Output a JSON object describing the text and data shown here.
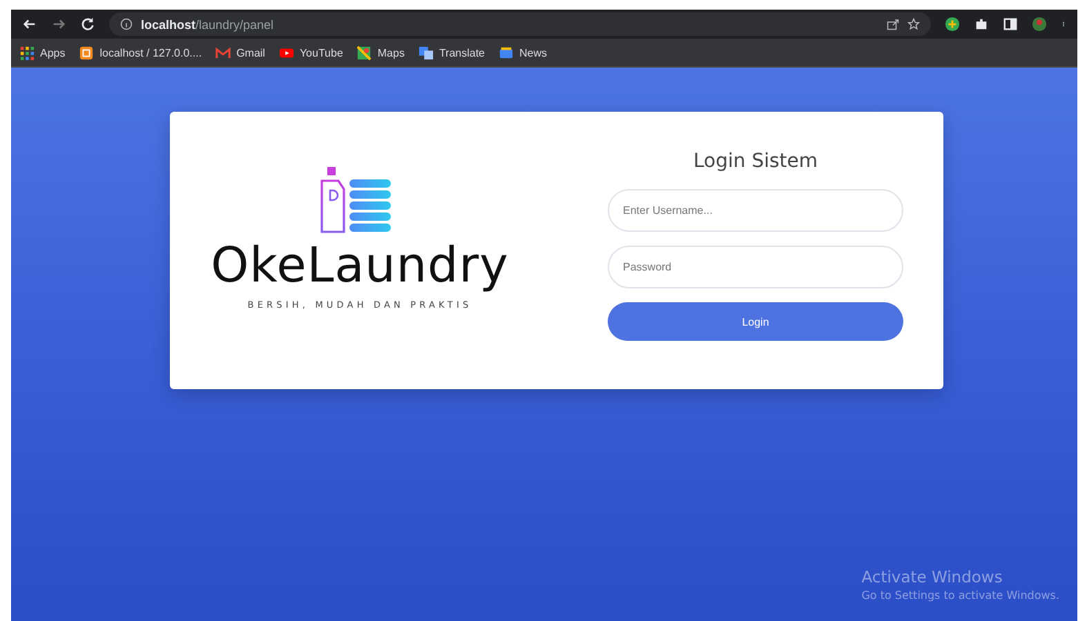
{
  "browser": {
    "url_host": "localhost",
    "url_path": "/laundry/panel",
    "bookmarks": [
      {
        "label": "Apps",
        "kind": "apps"
      },
      {
        "label": "localhost / 127.0.0....",
        "kind": "db"
      },
      {
        "label": "Gmail",
        "kind": "gmail"
      },
      {
        "label": "YouTube",
        "kind": "youtube"
      },
      {
        "label": "Maps",
        "kind": "maps"
      },
      {
        "label": "Translate",
        "kind": "translate"
      },
      {
        "label": "News",
        "kind": "news"
      }
    ]
  },
  "brand": {
    "name": "OkeLaundry",
    "tagline": "BERSIH, MUDAH DAN PRAKTIS"
  },
  "login": {
    "title": "Login Sistem",
    "username_placeholder": "Enter Username...",
    "password_placeholder": "Password",
    "button": "Login"
  },
  "activation": {
    "title": "Activate Windows",
    "subtitle": "Go to Settings to activate Windows."
  }
}
